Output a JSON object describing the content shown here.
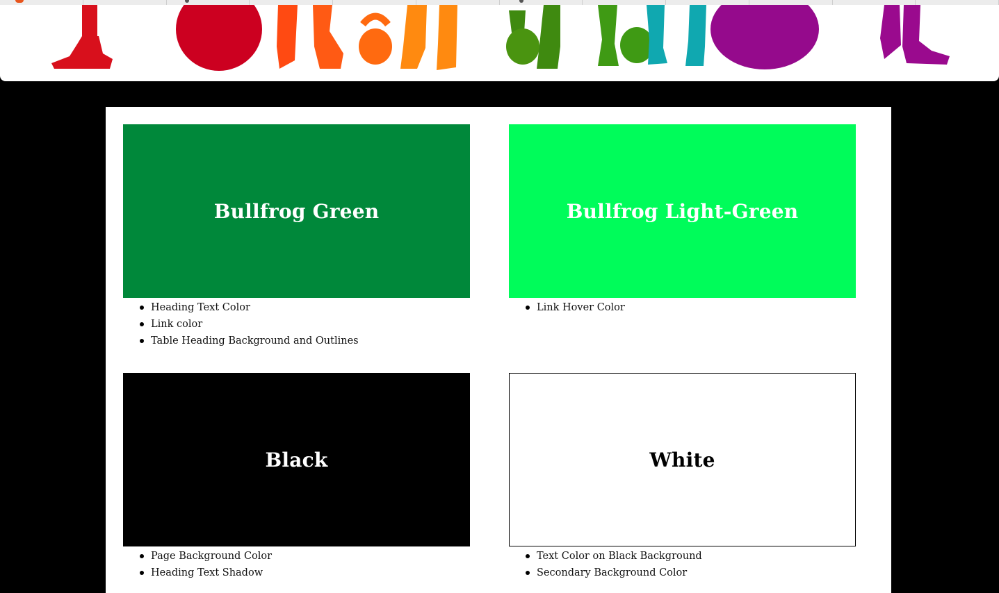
{
  "banner": {
    "figures": [
      {
        "name": "red-legs-figure",
        "color": "#d8101c"
      },
      {
        "name": "red-ball",
        "color": "#cc0020"
      },
      {
        "name": "orange-legs-figure",
        "color": "#ff4a12"
      },
      {
        "name": "orange-kettlebell",
        "color": "#ff6a10"
      },
      {
        "name": "orange-legs-figure-2",
        "color": "#ff8a10"
      },
      {
        "name": "green-kettlebell",
        "color": "#4a9410"
      },
      {
        "name": "green-legs-figure",
        "color": "#3f9a14"
      },
      {
        "name": "teal-legs-figure",
        "color": "#10a8b0"
      },
      {
        "name": "purple-ball",
        "color": "#950a8c"
      },
      {
        "name": "purple-legs-figure",
        "color": "#9a0a8e"
      }
    ]
  },
  "swatches": [
    {
      "title": "Bullfrog Green",
      "background": "#00883a",
      "text_color": "#ffffff",
      "uses": [
        "Heading Text Color",
        "Link color",
        "Table Heading Background and Outlines"
      ]
    },
    {
      "title": "Bullfrog Light-Green",
      "background": "#00fc5a",
      "text_color": "#ffffff",
      "uses": [
        "Link Hover Color"
      ]
    },
    {
      "title": "Black",
      "background": "#000000",
      "text_color": "#ffffff",
      "uses": [
        "Page Background Color",
        "Heading Text Shadow"
      ]
    },
    {
      "title": "White",
      "background": "#ffffff",
      "text_color": "#000000",
      "uses": [
        "Text Color on Black Background",
        "Secondary Background Color"
      ]
    }
  ]
}
